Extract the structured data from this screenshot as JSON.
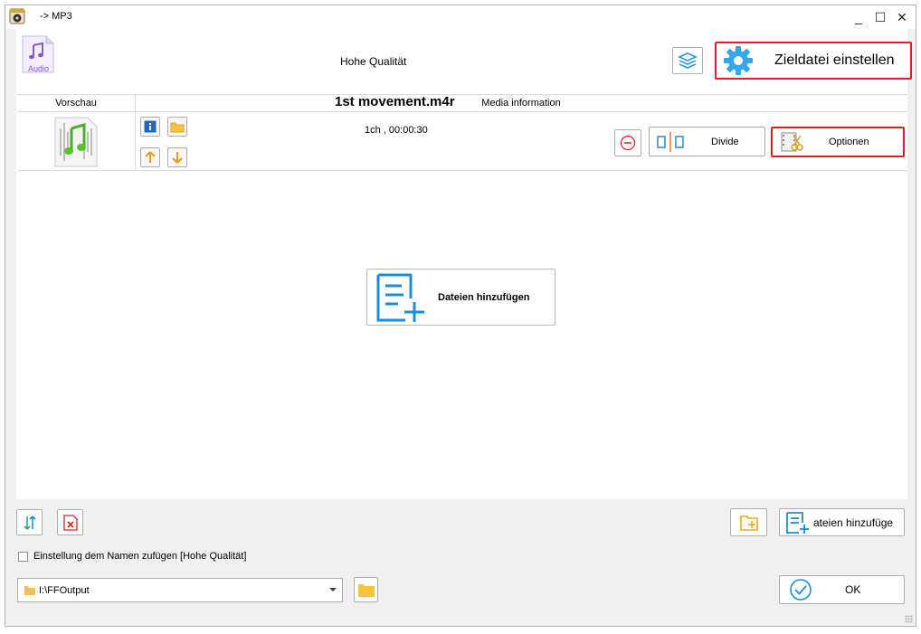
{
  "window": {
    "title": "-> MP3",
    "controls": {
      "minimize": "_",
      "maximize": "☐",
      "close": "✕"
    }
  },
  "profile": {
    "icon_label": "Audio",
    "quality_label": "Hohe Qualität",
    "target_button": "Zieldatei einstellen"
  },
  "grid": {
    "columns": [
      "Vorschau",
      "Media information"
    ],
    "rows": [
      {
        "filename": "1st movement.m4r",
        "meta": "1ch , 00:00:30"
      }
    ]
  },
  "row_actions": {
    "divide": "Divide",
    "options": "Optionen"
  },
  "empty_area": {
    "add_files": "Dateien hinzufügen"
  },
  "bottom": {
    "add_files_small": "ateien hinzufüge",
    "checkbox_label": "Einstellung dem Namen zufügen [Hohe Qualität]",
    "output_path": "I:\\FFOutput",
    "ok": "OK"
  },
  "colors": {
    "accent_blue": "#1a8fd6",
    "highlight_red": "#e0201b",
    "folder_yellow": "#f5c342",
    "arrow_orange": "#f09a1a"
  }
}
